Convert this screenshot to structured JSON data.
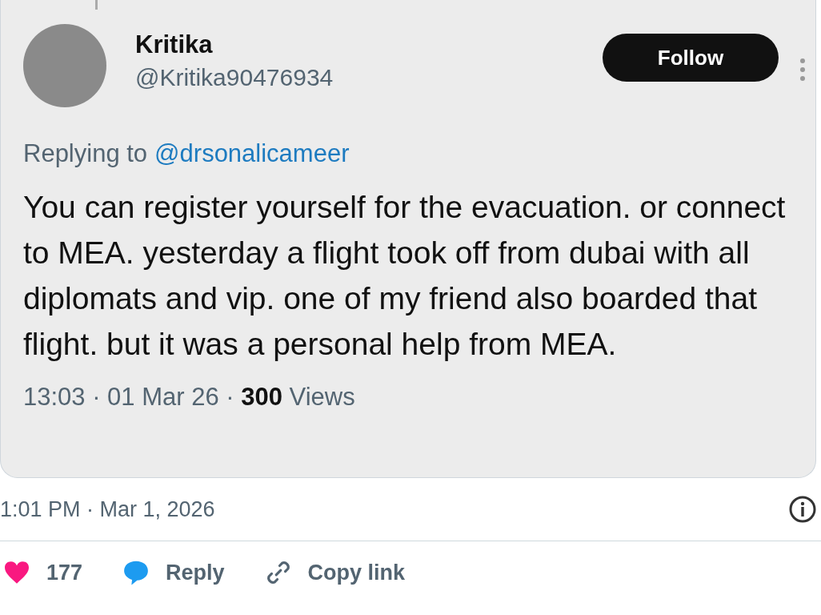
{
  "tweet_image": {
    "author": {
      "name": "Kritika",
      "handle": "@Kritika90476934"
    },
    "follow_button": "Follow",
    "replying_label": "Replying to",
    "replying_handle": "@drsonalicameer",
    "body": "You can register yourself for the evacuation. or connect to MEA. yesterday a flight took off from dubai with all diplomats and vip. one of my friend also boarded that flight. but it was a personal help from MEA.",
    "meta": "13:03 · 01 Mar 26 · **300** Views"
  },
  "timestamp": "1:01 PM · Mar 1, 2026",
  "actions": [
    {
      "kind": "like",
      "label": "177"
    },
    {
      "kind": "reply",
      "label": "Reply"
    },
    {
      "kind": "copy",
      "label": "Copy link"
    }
  ]
}
